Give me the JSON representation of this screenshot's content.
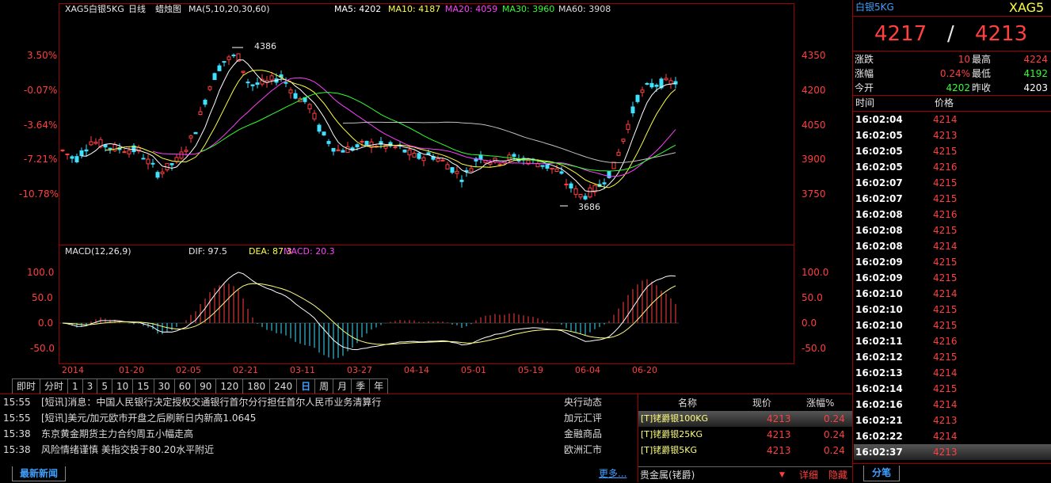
{
  "chart_header": {
    "symbol": "XAG5",
    "name": "白银5KG",
    "period": "日线",
    "type": "蜡烛图",
    "ma_params": "MA(5,10,20,30,60)",
    "ma": [
      {
        "label": "MA5:",
        "value": "4202"
      },
      {
        "label": "MA10:",
        "value": "4187"
      },
      {
        "label": "MA20:",
        "value": "4059"
      },
      {
        "label": "MA30:",
        "value": "3960"
      },
      {
        "label": "MA60:",
        "value": "3908"
      }
    ]
  },
  "colors": {
    "up": "#ff4040",
    "down": "#40e0ff",
    "ma5": "#ffffff",
    "ma10": "#ffff40",
    "ma20": "#ff40ff",
    "ma30": "#30ff30",
    "ma60": "#c0c0c0",
    "frame": "#a00000"
  },
  "left_axis": [
    "3.50%",
    "-0.07%",
    "-3.64%",
    "-7.21%",
    "-10.78%"
  ],
  "right_axis": [
    "4350",
    "4200",
    "4050",
    "3900",
    "3750"
  ],
  "high_marker": "4386",
  "low_marker": "3686",
  "macd_header": {
    "params": "MACD(12,26,9)",
    "dif_label": "DIF:",
    "dif": "97.5",
    "dea_label": "DEA:",
    "dea": "87.3",
    "macd_label": "MACD:",
    "macd": "20.3"
  },
  "macd_axis": [
    "100.0",
    "50.0",
    "0.0",
    "-50.0"
  ],
  "date_axis": [
    "2014",
    "01-20",
    "02-05",
    "02-21",
    "03-11",
    "03-27",
    "04-14",
    "05-01",
    "05-19",
    "06-04",
    "06-20"
  ],
  "period_tabs": [
    "即时",
    "分时",
    "1",
    "3",
    "5",
    "10",
    "15",
    "30",
    "60",
    "90",
    "120",
    "180",
    "240",
    "日",
    "周",
    "月",
    "季",
    "年"
  ],
  "news": [
    {
      "time": "15:55",
      "headline": "[短讯]消息：中国人民银行决定授权交通银行首尔分行担任首尔人民币业务清算行",
      "category": "央行动态"
    },
    {
      "time": "15:55",
      "headline": "[短讯]美元/加元欧市开盘之后刷新日内新高1.0645",
      "category": "加元汇评"
    },
    {
      "time": "15:38",
      "headline": "东京黄金期货主力合约周五小幅走高",
      "category": "金融商品"
    },
    {
      "time": "15:38",
      "headline": "风险情绪谨慎 美指交投于80.20水平附近",
      "category": "欧洲汇市"
    }
  ],
  "news_tab": "最新新闻",
  "more_link": "更多...",
  "quote_table": {
    "headers": [
      "名称",
      "现价",
      "涨幅%"
    ],
    "rows": [
      {
        "name": "[T]铑爵银100KG",
        "price": "4213",
        "change": "0.24"
      },
      {
        "name": "[T]铑爵银25KG",
        "price": "4213",
        "change": "0.24"
      },
      {
        "name": "[T]铑爵银5KG",
        "price": "4213",
        "change": "0.24"
      }
    ],
    "footer_select": "贵金属(铑爵)",
    "detail": "详细",
    "hide": "隐藏"
  },
  "side": {
    "name": "白银5KG",
    "code": "XAG5",
    "bid": "4217",
    "sep": "/",
    "ask": "4213",
    "stats": [
      {
        "l1": "涨跌",
        "v1": "10",
        "l2": "最高",
        "v2": "4224"
      },
      {
        "l1": "涨幅",
        "v1": "0.24%",
        "l2": "最低",
        "v2": "4192"
      },
      {
        "l1": "今开",
        "v1": "4202",
        "l2": "昨收",
        "v2": "4203"
      }
    ],
    "tick_headers": [
      "时间",
      "价格"
    ],
    "ticks": [
      {
        "t": "16:02:04",
        "p": "4214"
      },
      {
        "t": "16:02:05",
        "p": "4213"
      },
      {
        "t": "16:02:05",
        "p": "4215"
      },
      {
        "t": "16:02:05",
        "p": "4216"
      },
      {
        "t": "16:02:07",
        "p": "4215"
      },
      {
        "t": "16:02:07",
        "p": "4215"
      },
      {
        "t": "16:02:08",
        "p": "4216"
      },
      {
        "t": "16:02:08",
        "p": "4215"
      },
      {
        "t": "16:02:08",
        "p": "4214"
      },
      {
        "t": "16:02:09",
        "p": "4215"
      },
      {
        "t": "16:02:09",
        "p": "4215"
      },
      {
        "t": "16:02:10",
        "p": "4214"
      },
      {
        "t": "16:02:10",
        "p": "4215"
      },
      {
        "t": "16:02:10",
        "p": "4215"
      },
      {
        "t": "16:02:11",
        "p": "4216"
      },
      {
        "t": "16:02:12",
        "p": "4215"
      },
      {
        "t": "16:02:13",
        "p": "4214"
      },
      {
        "t": "16:02:14",
        "p": "4215"
      },
      {
        "t": "16:02:16",
        "p": "4214"
      },
      {
        "t": "16:02:21",
        "p": "4213"
      },
      {
        "t": "16:02:22",
        "p": "4214"
      },
      {
        "t": "16:02:37",
        "p": "4213"
      }
    ],
    "bottom_tab": "分笔"
  }
}
